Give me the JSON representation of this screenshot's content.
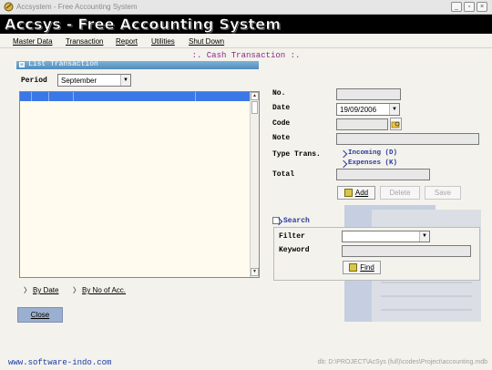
{
  "window": {
    "title": "Accsystem - Free Accounting System",
    "banner": "Accsys - Free Accounting System"
  },
  "menu": [
    "Master Data",
    "Transaction",
    "Report",
    "Utilities",
    "Shut Down"
  ],
  "form_title": ":. Cash Transaction :.",
  "list_panel": {
    "header": "List Transaction",
    "period_label": "Period",
    "period_value": "September",
    "link_by_date": "By Date",
    "link_by_acc": "By No of Acc."
  },
  "detail": {
    "no_label": "No.",
    "no_value": "",
    "date_label": "Date",
    "date_value": "19/09/2006",
    "code_label": "Code",
    "code_value": "",
    "note_label": "Note",
    "note_value": "",
    "type_label": "Type Trans.",
    "type_incoming": "Incoming (D)",
    "type_expenses": "Expenses (K)",
    "total_label": "Total",
    "total_value": ""
  },
  "buttons": {
    "add": "Add",
    "delete": "Delete",
    "save": "Save",
    "find": "Find",
    "close": "Close"
  },
  "search": {
    "label": "Search",
    "filter_label": "Filter",
    "filter_value": "",
    "keyword_label": "Keyword",
    "keyword_value": ""
  },
  "footer": {
    "url": "www.software-indo.com",
    "db_path": "db: D:\\PROJECT\\AcSys (full)\\codes\\Project\\accounting.mdb"
  }
}
